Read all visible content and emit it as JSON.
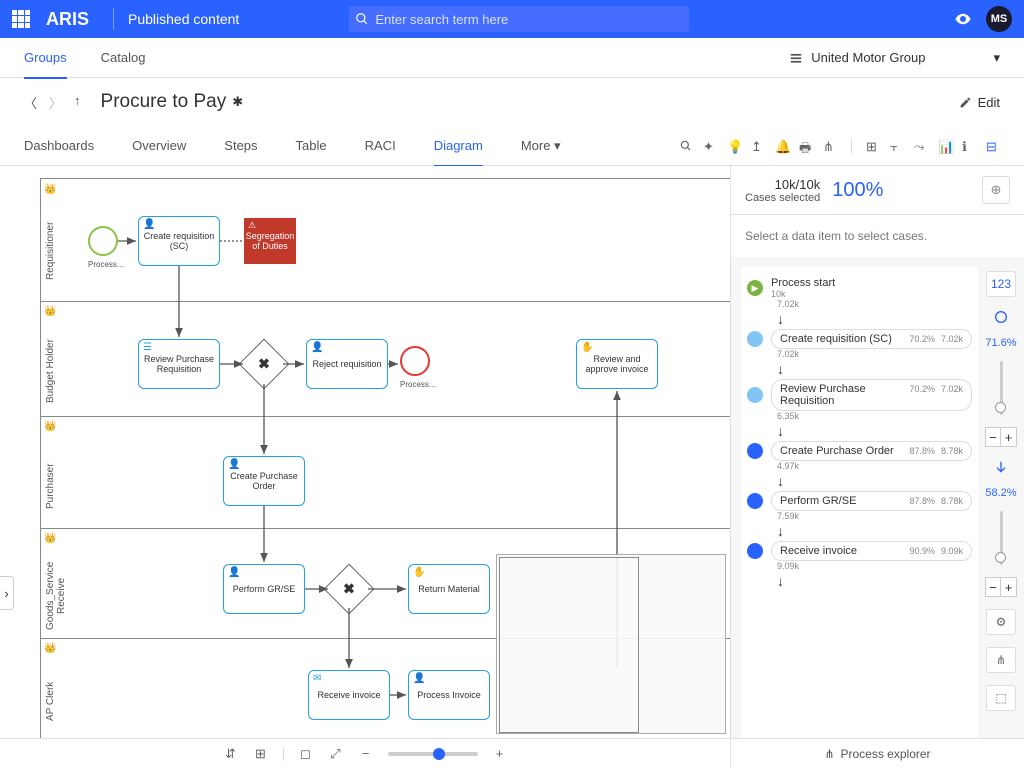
{
  "header": {
    "logo": "ARIS",
    "subtitle": "Published content",
    "search_placeholder": "Enter search term here",
    "user_initials": "MS"
  },
  "secondary_nav": {
    "tabs": [
      "Groups",
      "Catalog"
    ],
    "active": "Groups",
    "tenant": "United Motor Group"
  },
  "breadcrumb": {
    "title": "Procure to Pay",
    "edit_label": "Edit"
  },
  "content_tabs": {
    "items": [
      "Dashboards",
      "Overview",
      "Steps",
      "Table",
      "RACI",
      "Diagram",
      "More"
    ],
    "active": "Diagram"
  },
  "lanes": [
    {
      "name": "Requisitioner"
    },
    {
      "name": "Budget Holder"
    },
    {
      "name": "Purchaser"
    },
    {
      "name": "Goods_Service Receive"
    },
    {
      "name": "AP Clerk"
    }
  ],
  "nodes": {
    "start_label": "Process...",
    "create_req": "Create requisition (SC)",
    "sod": "Segregation of Duties",
    "review_pr": "Review Purchase Requisition",
    "reject_req": "Reject requisition",
    "end_label": "Process...",
    "approve_inv": "Review and approve invoice",
    "create_po": "Create Purchase Order",
    "perform_gr": "Perform GR/SE",
    "return_mat": "Return Material",
    "receive_inv": "Receive invoice",
    "process_inv": "Process Invoice"
  },
  "right_panel": {
    "cases_count": "10k/10k",
    "cases_label": "Cases selected",
    "percent": "100%",
    "hint": "Select a data item to select cases.",
    "side_pct1": "71.6%",
    "side_pct2": "58.2%",
    "explorer_label": "Process explorer",
    "flow": [
      {
        "name": "Process start",
        "sub": "10k",
        "pct": "",
        "bullet": "start"
      },
      {
        "edge": "7.02k"
      },
      {
        "name": "Create requisition (SC)",
        "sub": "7.02k",
        "pct": "70.2%",
        "bullet": "light"
      },
      {
        "edge": "7.02k"
      },
      {
        "name": "Review Purchase Requisition",
        "sub": "7.02k",
        "pct": "70.2%",
        "bullet": "light"
      },
      {
        "edge": "6.35k"
      },
      {
        "name": "Create Purchase Order",
        "sub": "8.78k",
        "pct": "87.8%",
        "bullet": "dark"
      },
      {
        "edge": "4.97k"
      },
      {
        "name": "Perform GR/SE",
        "sub": "8.78k",
        "pct": "87.8%",
        "bullet": "dark"
      },
      {
        "edge": "7.59k"
      },
      {
        "name": "Receive invoice",
        "sub": "9.09k",
        "pct": "90.9%",
        "bullet": "dark"
      },
      {
        "edge": "9.09k"
      }
    ]
  }
}
